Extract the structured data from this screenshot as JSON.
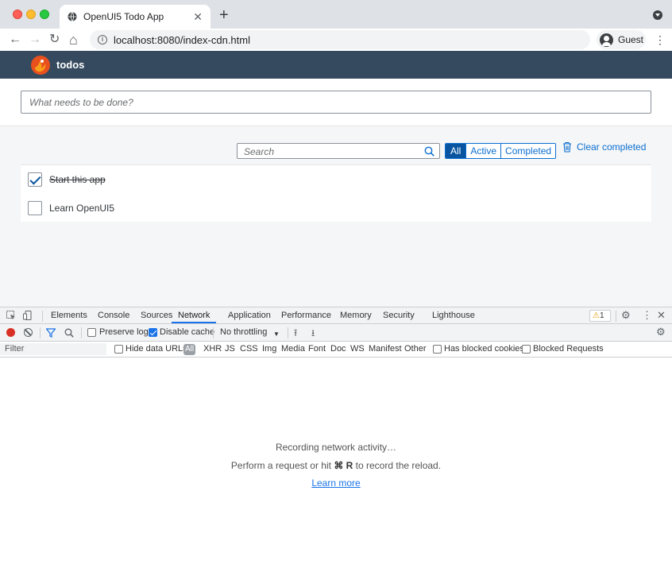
{
  "browser": {
    "tab_title": "OpenUI5 Todo App",
    "new_tab": "+",
    "tab_close": "✕",
    "url": "localhost:8080/index-cdn.html",
    "profile_label": "Guest",
    "menu": "⋮",
    "back": "←",
    "forward": "→",
    "reload": "↻",
    "home": "⌂"
  },
  "app": {
    "title": "todos",
    "new_todo_placeholder": "What needs to be done?",
    "search_placeholder": "Search",
    "filters": [
      "All",
      "Active",
      "Completed"
    ],
    "selected_filter": "All",
    "clear_completed": "Clear completed",
    "todos": [
      {
        "title": "Start this app",
        "completed": true
      },
      {
        "title": "Learn OpenUI5",
        "completed": false
      }
    ],
    "colors": {
      "shell": "#354a5f",
      "accent": "#0a6ed1",
      "selected": "#0854a0"
    }
  },
  "devtools": {
    "tabs": [
      "Elements",
      "Console",
      "Sources",
      "Network",
      "Application",
      "Performance",
      "Memory",
      "Security",
      "Lighthouse"
    ],
    "active_tab": "Network",
    "warnings_count": "1",
    "warning_glyph": "⚠",
    "close": "✕",
    "settings": "⚙",
    "menu": "⋮",
    "toolbar": {
      "preserve_log": "Preserve log",
      "disable_cache": "Disable cache",
      "throttling": "No throttling",
      "throttling_arrow": "▼",
      "import_glyph": "⭱",
      "export_glyph": "⭳",
      "settings": "⚙"
    },
    "filter_row": {
      "filter_placeholder": "Filter",
      "hide_data_urls": "Hide data URLs",
      "all": "All",
      "types": [
        "XHR",
        "JS",
        "CSS",
        "Img",
        "Media",
        "Font",
        "Doc",
        "WS",
        "Manifest",
        "Other"
      ],
      "has_blocked_cookies": "Has blocked cookies",
      "blocked_requests": "Blocked Requests"
    },
    "empty": {
      "line1": "Recording network activity…",
      "line2_pre": "Perform a request or hit",
      "shortcut": "⌘ R",
      "line2_post": "to record the reload.",
      "learn_more": "Learn more"
    }
  }
}
